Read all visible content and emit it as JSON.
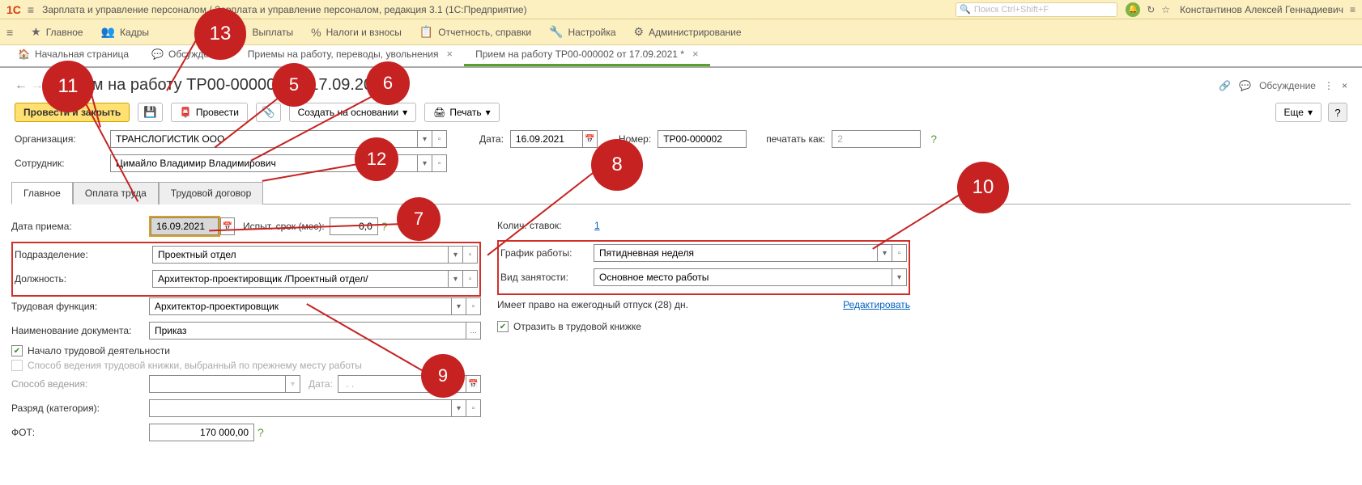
{
  "titlebar": {
    "logo": "1C",
    "app_title": "Зарплата и управление персоналом / Зарплата и управление персоналом, редакция 3.1 (1С:Предприятие)",
    "search_placeholder": "Поиск Ctrl+Shift+F",
    "user": "Константинов Алексей Геннадиевич"
  },
  "mainmenu": {
    "items": [
      {
        "icon": "★",
        "label": "Главное"
      },
      {
        "icon": "👥",
        "label": "Кадры"
      },
      {
        "icon": "🧮",
        "label": "Выплаты"
      },
      {
        "icon": "%",
        "label": "Налоги и взносы"
      },
      {
        "icon": "📋",
        "label": "Отчетность, справки"
      },
      {
        "icon": "🔧",
        "label": "Настройка"
      },
      {
        "icon": "⚙",
        "label": "Администрирование"
      }
    ]
  },
  "tabs": [
    {
      "icon": "🏠",
      "label": "Начальная страница",
      "close": false
    },
    {
      "icon": "💬",
      "label": "Обсуждения",
      "close": false
    },
    {
      "icon": "",
      "label": "Приемы на работу, переводы, увольнения",
      "close": true
    },
    {
      "icon": "",
      "label": "Прием на работу ТР00-000002 от 17.09.2021 *",
      "close": true,
      "active": true
    }
  ],
  "page": {
    "title": "Прием на работу ТР00-000002 от 17.09.2021 *",
    "discuss": "Обсуждение"
  },
  "toolbar": {
    "primary": "Провести и закрыть",
    "provesti": "Провести",
    "create_based": "Создать на основании",
    "print": "Печать",
    "more": "Еще",
    "help": "?"
  },
  "header_fields": {
    "org_label": "Организация:",
    "org_value": "ТРАНСЛОГИСТИК ООО",
    "date_label": "Дата:",
    "date_value": "16.09.2021",
    "number_label": "Номер:",
    "number_value": "ТР00-000002",
    "print_as_label": "печатать как:",
    "print_as_value": "2",
    "employee_label": "Сотрудник:",
    "employee_value": "Цимайло Владимир Владимирович"
  },
  "inner_tabs": [
    "Главное",
    "Оплата труда",
    "Трудовой договор"
  ],
  "left": {
    "hire_date_label": "Дата приема:",
    "hire_date_value": "16.09.2021",
    "probation_label": "Испыт. срок (мес):",
    "probation_value": "0,0",
    "dept_label": "Подразделение:",
    "dept_value": "Проектный отдел",
    "position_label": "Должность:",
    "position_value": "Архитектор-проектировщик /Проектный отдел/",
    "func_label": "Трудовая функция:",
    "func_value": "Архитектор-проектировщик",
    "docname_label": "Наименование документа:",
    "docname_value": "Приказ",
    "start_work_chk": "Начало трудовой деятельности",
    "prev_method_chk": "Способ ведения трудовой книжки, выбранный по прежнему месту работы",
    "method_label": "Способ ведения:",
    "method_date_label": "Дата:",
    "method_date_value": " . . ",
    "rank_label": "Разряд (категория):",
    "fot_label": "ФОТ:",
    "fot_value": "170 000,00"
  },
  "right": {
    "stavok_label": "Колич. ставок:",
    "stavok_value": "1",
    "schedule_label": "График работы:",
    "schedule_value": "Пятидневная неделя",
    "emptype_label": "Вид занятости:",
    "emptype_value": "Основное место работы",
    "vacation_text": "Имеет право на ежегодный отпуск (28) дн.",
    "edit_link": "Редактировать",
    "workbook_chk": "Отразить в трудовой книжке"
  }
}
